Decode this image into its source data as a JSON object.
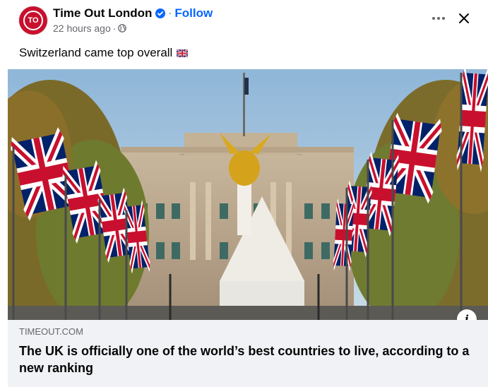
{
  "post": {
    "page_name": "Time Out London",
    "avatar_text": "TO",
    "separator": "·",
    "follow_label": "Follow",
    "timestamp": "22 hours ago",
    "time_separator": "·",
    "audience_icon": "globe-icon",
    "caption": "Switzerland came top overall",
    "caption_emoji": "uk-flag-emoji",
    "more_icon": "more-options-icon",
    "close_icon": "close-icon"
  },
  "link_preview": {
    "image_alt": "Buckingham Palace with Union Jack flags along The Mall",
    "domain": "TIMEOUT.COM",
    "headline": "The UK is officially one of the world’s best countries to live, according to a new ranking",
    "info_label": "i"
  },
  "colors": {
    "brand_red": "#c8102e",
    "link_blue": "#0866ff",
    "secondary_text": "#65676b",
    "preview_bg": "#f0f2f5"
  }
}
